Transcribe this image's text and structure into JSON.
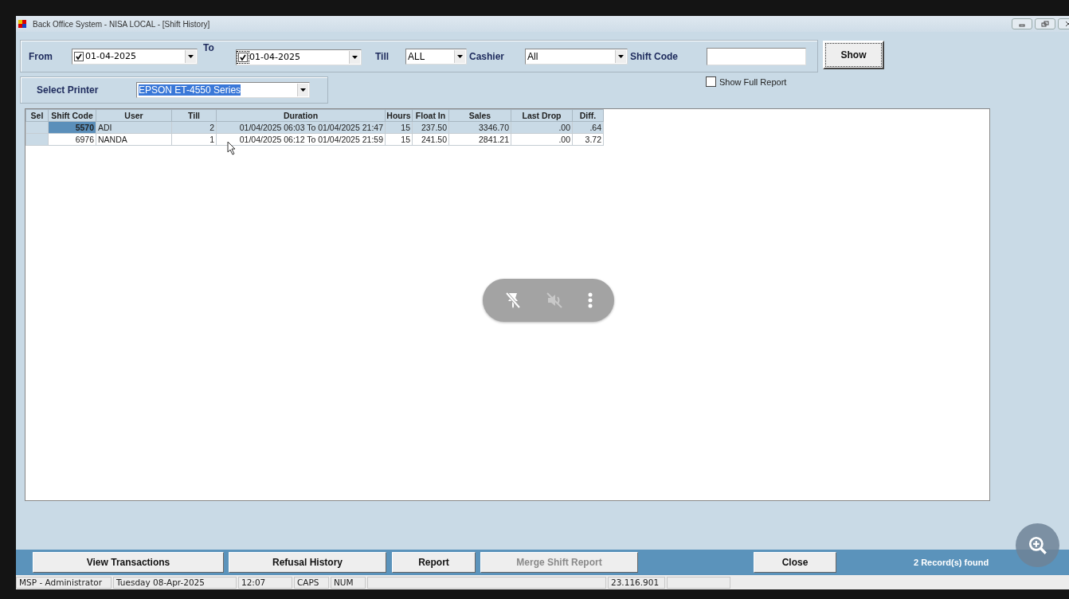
{
  "window": {
    "title": "Back Office System - NISA LOCAL - [Shift History]"
  },
  "filters": {
    "from": {
      "label": "From",
      "checked": true,
      "value": "01-04-2025"
    },
    "to": {
      "label": "To",
      "checked": true,
      "value": "01-04-2025"
    },
    "till": {
      "label": "Till",
      "value": "ALL"
    },
    "cashier": {
      "label": "Cashier",
      "value": "All"
    },
    "shift_code": {
      "label": "Shift Code"
    },
    "show_button": "Show",
    "show_full_report": {
      "label": "Show Full Report",
      "checked": false
    }
  },
  "printer": {
    "label": "Select Printer",
    "value": "EPSON ET-4550 Series"
  },
  "table": {
    "columns": [
      "Sel",
      "Shift Code",
      "User",
      "Till",
      "Duration",
      "Hours",
      "Float In",
      "Sales",
      "Last Drop",
      "Diff."
    ],
    "rows": [
      {
        "selected": true,
        "cells": [
          "",
          "5570",
          "ADI",
          "2",
          "01/04/2025 06:03 To 01/04/2025 21:47",
          "15",
          "237.50",
          "3346.70",
          ".00",
          ".64"
        ]
      },
      {
        "selected": false,
        "cells": [
          "",
          "6976",
          "NANDA",
          "1",
          "01/04/2025 06:12 To 01/04/2025 21:59",
          "15",
          "241.50",
          "2841.21",
          ".00",
          "3.72"
        ]
      }
    ]
  },
  "buttons": [
    {
      "label": "View Transactions",
      "disabled": false
    },
    {
      "label": "Refusal History",
      "disabled": false
    },
    {
      "label": "Report",
      "disabled": false
    },
    {
      "label": "Merge Shift Report",
      "disabled": true
    },
    {
      "label": "Close",
      "disabled": false
    }
  ],
  "record_count": "2 Record(s) found",
  "status_bar": [
    "MSP - Administrator",
    "Tuesday 08-Apr-2025",
    "12:07",
    "CAPS",
    "NUM",
    "23.116.901"
  ]
}
